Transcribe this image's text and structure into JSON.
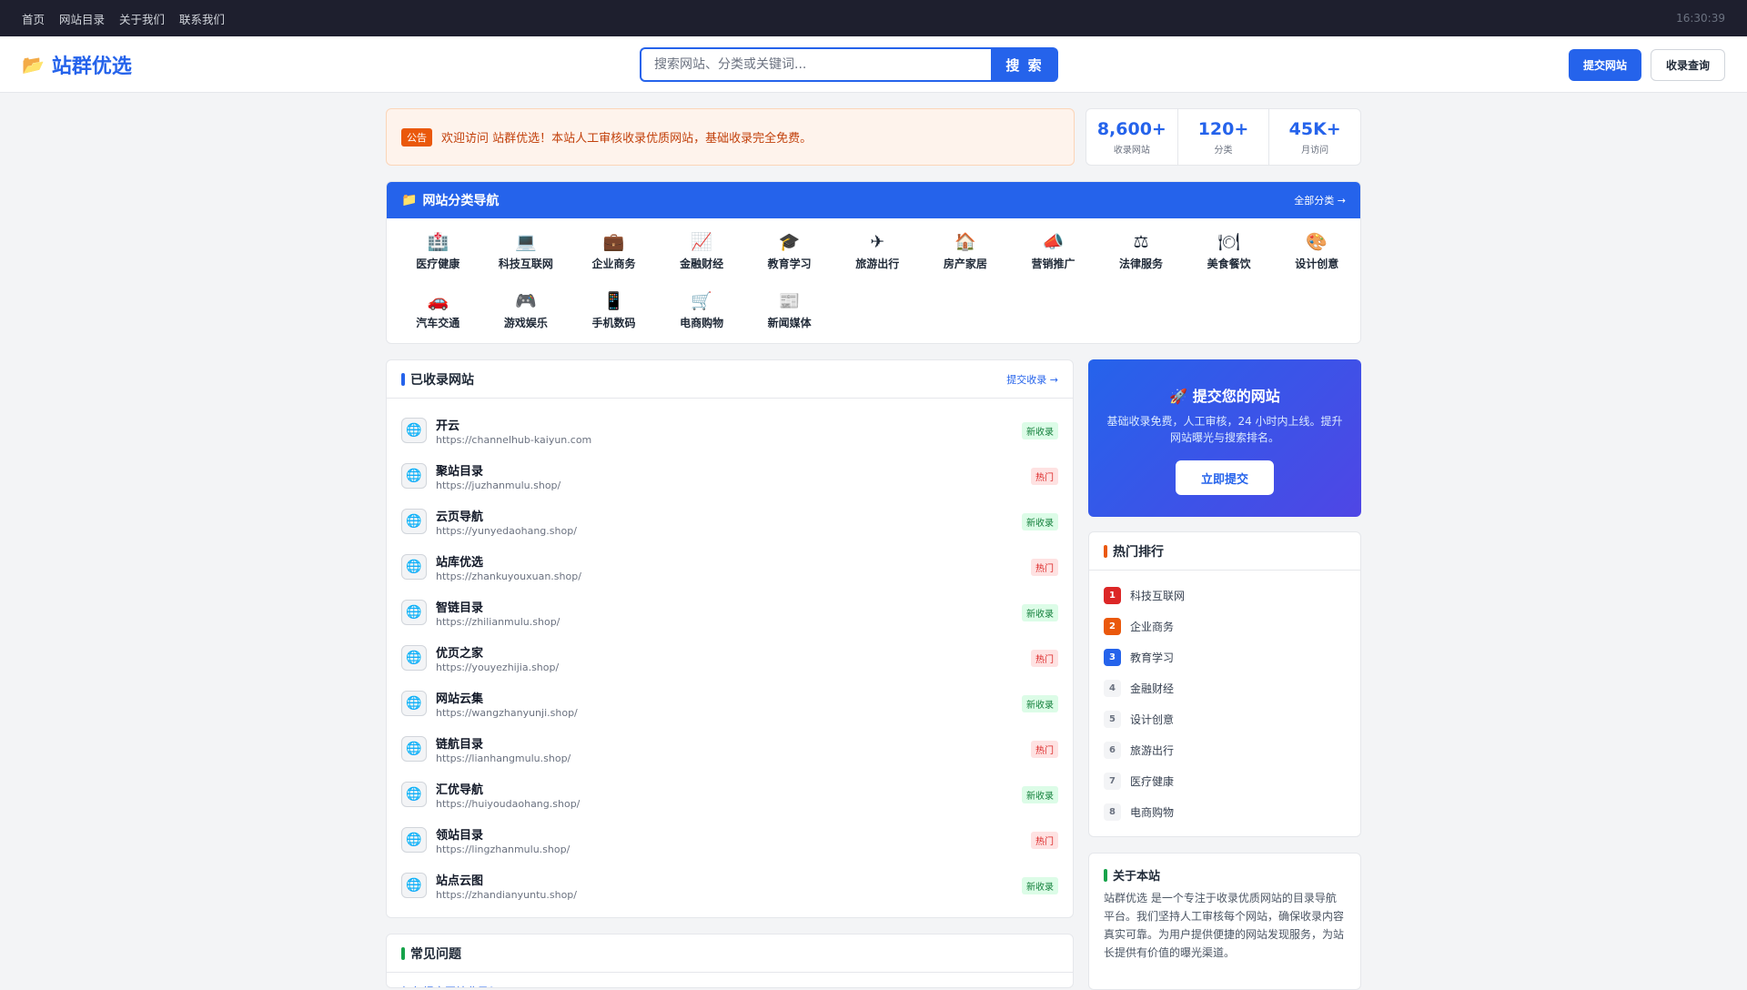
{
  "topbar": {
    "nav": [
      "首页",
      "网站目录",
      "关于我们",
      "联系我们"
    ],
    "time": "16:30:39"
  },
  "header": {
    "logo_icon": "folder-icon",
    "logo_text": "站群优选",
    "search_placeholder": "搜索网站、分类或关键词...",
    "search_button": "搜 索",
    "submit_button": "提交网站",
    "query_button": "收录查询"
  },
  "notice": {
    "tag": "公告",
    "text": "欢迎访问 站群优选！本站人工审核收录优质网站，基础收录完全免费。"
  },
  "stats": [
    {
      "num": "8,600+",
      "label": "收录网站"
    },
    {
      "num": "120+",
      "label": "分类"
    },
    {
      "num": "45K+",
      "label": "月访问"
    }
  ],
  "categories": {
    "title": "网站分类导航",
    "more": "全部分类 →",
    "items": [
      {
        "icon": "🏥",
        "icon_name": "hospital-icon",
        "label": "医疗健康"
      },
      {
        "icon": "💻",
        "icon_name": "laptop-icon",
        "label": "科技互联网"
      },
      {
        "icon": "💼",
        "icon_name": "briefcase-icon",
        "label": "企业商务"
      },
      {
        "icon": "📈",
        "icon_name": "chart-up-icon",
        "label": "金融财经"
      },
      {
        "icon": "🎓",
        "icon_name": "graduation-cap-icon",
        "label": "教育学习"
      },
      {
        "icon": "✈",
        "icon_name": "airplane-icon",
        "label": "旅游出行"
      },
      {
        "icon": "🏠",
        "icon_name": "house-icon",
        "label": "房产家居"
      },
      {
        "icon": "📣",
        "icon_name": "megaphone-icon",
        "label": "营销推广"
      },
      {
        "icon": "⚖",
        "icon_name": "scales-icon",
        "label": "法律服务"
      },
      {
        "icon": "🍽",
        "icon_name": "plate-icon",
        "label": "美食餐饮"
      },
      {
        "icon": "🎨",
        "icon_name": "palette-icon",
        "label": "设计创意"
      },
      {
        "icon": "🚗",
        "icon_name": "car-icon",
        "label": "汽车交通"
      },
      {
        "icon": "🎮",
        "icon_name": "gamepad-icon",
        "label": "游戏娱乐"
      },
      {
        "icon": "📱",
        "icon_name": "phone-icon",
        "label": "手机数码"
      },
      {
        "icon": "🛒",
        "icon_name": "cart-icon",
        "label": "电商购物"
      },
      {
        "icon": "📰",
        "icon_name": "newspaper-icon",
        "label": "新闻媒体"
      }
    ]
  },
  "sites": {
    "title": "已收录网站",
    "link": "提交收录 →",
    "items": [
      {
        "name": "开云",
        "url": "https://channelhub-kaiyun.com",
        "badge": "新收录",
        "type": "new"
      },
      {
        "name": "聚站目录",
        "url": "https://juzhanmulu.shop/",
        "badge": "热门",
        "type": "hot"
      },
      {
        "name": "云页导航",
        "url": "https://yunyedaohang.shop/",
        "badge": "新收录",
        "type": "new"
      },
      {
        "name": "站库优选",
        "url": "https://zhankuyouxuan.shop/",
        "badge": "热门",
        "type": "hot"
      },
      {
        "name": "智链目录",
        "url": "https://zhilianmulu.shop/",
        "badge": "新收录",
        "type": "new"
      },
      {
        "name": "优页之家",
        "url": "https://youyezhijia.shop/",
        "badge": "热门",
        "type": "hot"
      },
      {
        "name": "网站云集",
        "url": "https://wangzhanyunji.shop/",
        "badge": "新收录",
        "type": "new"
      },
      {
        "name": "链航目录",
        "url": "https://lianhangmulu.shop/",
        "badge": "热门",
        "type": "hot"
      },
      {
        "name": "汇优导航",
        "url": "https://huiyoudaohang.shop/",
        "badge": "新收录",
        "type": "new"
      },
      {
        "name": "领站目录",
        "url": "https://lingzhanmulu.shop/",
        "badge": "热门",
        "type": "hot"
      },
      {
        "name": "站点云图",
        "url": "https://zhandianyuntu.shop/",
        "badge": "新收录",
        "type": "new"
      }
    ]
  },
  "faq": {
    "title": "常见问题",
    "first_question": "如何提交网站收录？"
  },
  "submit_card": {
    "title": "🚀 提交您的网站",
    "desc": "基础收录免费，人工审核，24 小时内上线。提升网站曝光与搜索排名。",
    "button": "立即提交"
  },
  "ranking": {
    "title": "热门排行",
    "items": [
      "科技互联网",
      "企业商务",
      "教育学习",
      "金融财经",
      "设计创意",
      "旅游出行",
      "医疗健康",
      "电商购物"
    ]
  },
  "about": {
    "title": "关于本站",
    "text": "站群优选 是一个专注于收录优质网站的目录导航平台。我们坚持人工审核每个网站，确保收录内容真实可靠。为用户提供便捷的网站发现服务，为站长提供有价值的曝光渠道。"
  },
  "colors": {
    "accent": "#2563eb",
    "notice": "#ea580c",
    "new_badge": "#15803d",
    "hot_badge": "#dc2626"
  }
}
